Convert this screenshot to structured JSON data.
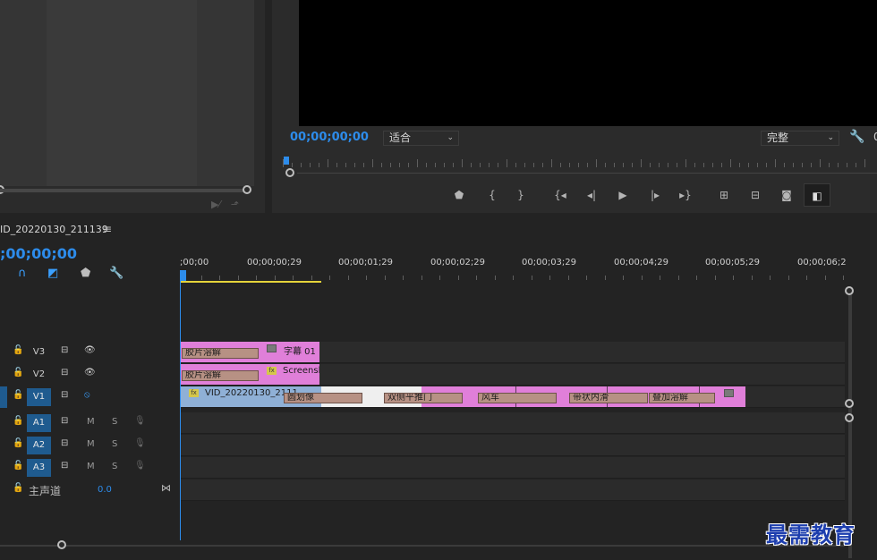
{
  "source_monitor": {
    "icons": [
      "insert-icon",
      "export-frame-icon"
    ]
  },
  "program_monitor": {
    "timecode": "00;00;00;00",
    "fit_label": "适合",
    "resolution_label": "完整",
    "extra_label": "0",
    "transport_icons": [
      "add-marker-icon",
      "mark-in-icon",
      "mark-out-icon",
      "go-to-in-icon",
      "step-back-icon",
      "play-icon",
      "step-forward-icon",
      "go-to-out-icon",
      "lift-icon",
      "extract-icon",
      "export-frame-icon",
      "comparison-view-icon"
    ]
  },
  "timeline": {
    "sequence_name": "ID_20220130_211139",
    "menu_glyph": "≡",
    "timecode": ";00;00;00",
    "ruler_labels": [
      ";00;00",
      "00;00;00;29",
      "00;00;01;29",
      "00;00;02;29",
      "00;00;03;29",
      "00;00;04;29",
      "00;00;05;29",
      "00;00;06;2"
    ],
    "tracks": {
      "v3": {
        "name": "V3"
      },
      "v2": {
        "name": "V2"
      },
      "v1": {
        "name": "V1"
      },
      "a1": {
        "name": "A1",
        "m": "M",
        "s": "S"
      },
      "a2": {
        "name": "A2",
        "m": "M",
        "s": "S"
      },
      "a3": {
        "name": "A3",
        "m": "M",
        "s": "S"
      },
      "master": {
        "name": "主声道",
        "value": "0.0"
      }
    },
    "clips": {
      "v3_transition": "胶片溶解",
      "v3_title": "字幕 01",
      "v2_transition": "胶片溶解",
      "v2_title": "Screensh",
      "v1_title": "VID_20220130_2111",
      "v1_transitions": [
        "圆划像",
        "双侧平推门",
        "风车",
        "带状内滑",
        "叠加溶解"
      ]
    },
    "watermark": "最需教育"
  },
  "colors": {
    "accent": "#2d8ceb",
    "clip_pink": "#e07fd9",
    "clip_blue": "#8fb0d6",
    "transition": "#b79184",
    "work_area": "#e5d33a"
  }
}
